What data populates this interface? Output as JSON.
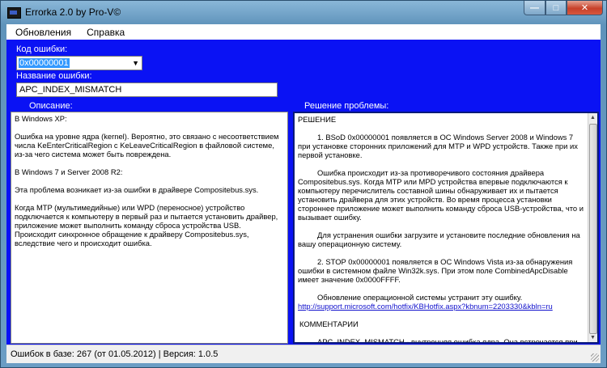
{
  "window": {
    "title": "Errorka 2.0 by Pro-V©",
    "minimize_glyph": "—",
    "maximize_glyph": "□",
    "close_glyph": "✕"
  },
  "menu": {
    "items": [
      "Обновления",
      "Справка"
    ]
  },
  "form": {
    "code_label": "Код ошибки:",
    "code_value": "0x00000001",
    "name_label": "Название ошибки:",
    "name_value": "APC_INDEX_MISMATCH",
    "description_label": "Описание:",
    "solution_label": "Решение проблемы:"
  },
  "description": {
    "lines": [
      "В Windows XP:",
      "",
      "Ошибка на уровне ядра (kernel). Вероятно, это связано с несоответствием числа KeEnterCriticalRegion с KeLeaveCriticalRegion в файловой системе, из-за чего система может быть повреждена.",
      "",
      "В Windows 7 и Server 2008 R2:",
      "",
      "Эта проблема возникает из-за ошибки в драйвере Compositebus.sys.",
      "",
      "Когда MTP (мультимедийные)  или WPD (переносное) устройство подключается к компьютеру в первый раз и пытается установить драйвер, приложение может выполнить команду сброса устройства USB. Происходит синхронное обращение к драйверу Compositebus.sys, вследствие чего и происходит ошибка."
    ]
  },
  "solution": {
    "heading": "РЕШЕНИЕ",
    "p1": "1. BSoD 0x00000001 появляется в ОС Windows Server 2008 и Windows 7 при установке сторонних приложений для MTP и WPD устройств. Также при их первой установке.",
    "p2": "Ошибка происходит из-за противоречивого состояния драйвера Compositebus.sys. Когда MTP или MPD устройства впервые подключаются к компьютеру перечислитель составной шины обнаруживает их и пытается установить драйвера для этих устройств. Во время процесса установки стороннее приложение может выполнить команду сброса USB-устройства, что и вызывает ошибку.",
    "p3": "Для устранения ошибки загрузите и установите последние обновления на вашу операционную систему.",
    "p4": "2. STOP 0x00000001 появляется в ОС Windows Vista из-за обнаружения ошибки в системном файле Win32k.sys. При этом поле CombinedApcDisable имеет значение 0x0000FFFF.",
    "p5": "Обновление операционной системы устранит эту ошибку.",
    "link": "http://support.microsoft.com/hotfix/KBHotfix.aspx?kbnum=2203330&kbln=ru",
    "comments_heading": "КОММЕНТАРИИ",
    "p6": "APC_INDEX_MISMATCH  - внутренняя ошибка ядра. Она встречается при"
  },
  "status": {
    "text": "Ошибок в базе: 267 (от 01.05.2012) | Версия: 1.0.5"
  },
  "colors": {
    "form_background": "#0a12f4",
    "selection": "#3399ff"
  }
}
